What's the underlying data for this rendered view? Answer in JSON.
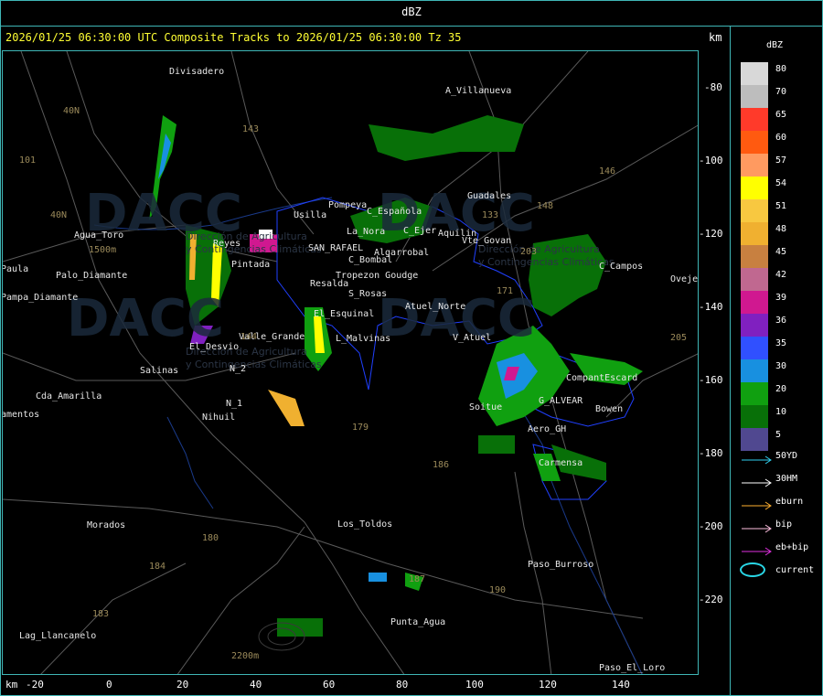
{
  "window": {
    "title": "dBZ"
  },
  "header": {
    "text": "2026/01/25 06:30:00 UTC Composite Tracks to 2026/01/25 06:30:00 Tz 35",
    "km": "km"
  },
  "axes": {
    "x_ticks": [
      "-20",
      "0",
      "20",
      "40",
      "60",
      "80",
      "100",
      "120",
      "140"
    ],
    "y_ticks": [
      "-80",
      "-100",
      "-120",
      "-140",
      "-160",
      "-180",
      "-200",
      "-220"
    ],
    "x_unit": "km"
  },
  "places": [
    "Divisadero",
    "A_Villanueva",
    "Guadales",
    "Usilla",
    "Pompeya",
    "C_Española",
    "La_Nora",
    "C_Ejer",
    "Aquilin",
    "Vte_Govan",
    "Algarrobal",
    "C_Bombal",
    "SAN_RAFAEL",
    "Tropezon Goudge",
    "Resalda",
    "S_Rosas",
    "Atuel_Norte",
    "C_Campos",
    "Oveje",
    "Agua_Toro",
    "Pampa_Diamante",
    "Palo_Diamante",
    "Paula",
    "Pintada",
    "Reyes",
    "El_Desvio",
    "Valle_Grande",
    "El_Esquinal",
    "L_Malvinas",
    "V_Atuel",
    "Salinas",
    "Cda_Amarilla",
    "amentos",
    "N_2",
    "N_1",
    "Nihuil",
    "Soitue",
    "G_ALVEAR",
    "CompantEscard",
    "Bowen",
    "Aero_GH",
    "Carmensa",
    "Morados",
    "Los_Toldos",
    "Paso_Burroso",
    "Lag_Llancanelo",
    "Punta_Agua",
    "Paso_El_Loro",
    "1500m",
    "2200m",
    "40N",
    "101",
    "143",
    "146",
    "133",
    "148",
    "203",
    "171",
    "144",
    "179",
    "186",
    "180",
    "184",
    "183",
    "190",
    "205",
    "187",
    "40N"
  ],
  "watermarks": [
    "DACC",
    "DACC",
    "DACC",
    "DACC"
  ],
  "watermark_sub": [
    "Dirección de Agricultura",
    "y Contingencias Climáticas"
  ],
  "legend": {
    "title": "dBZ",
    "levels": [
      {
        "label": "80",
        "color": "#d8d8d8"
      },
      {
        "label": "70",
        "color": "#bdbdbd"
      },
      {
        "label": "65",
        "color": "#ff3a2a"
      },
      {
        "label": "60",
        "color": "#ff5a10"
      },
      {
        "label": "57",
        "color": "#ff9a60"
      },
      {
        "label": "54",
        "color": "#ffff00"
      },
      {
        "label": "51",
        "color": "#f8c840"
      },
      {
        "label": "48",
        "color": "#f0b030"
      },
      {
        "label": "45",
        "color": "#c88040"
      },
      {
        "label": "42",
        "color": "#c06890"
      },
      {
        "label": "39",
        "color": "#d01890"
      },
      {
        "label": "36",
        "color": "#8020c0"
      },
      {
        "label": "35",
        "color": "#3050ff"
      },
      {
        "label": "30",
        "color": "#1890e0"
      },
      {
        "label": "20",
        "color": "#10a010"
      },
      {
        "label": "10",
        "color": "#087008"
      },
      {
        "label": "5",
        "color": "#504890"
      }
    ],
    "tracks": [
      {
        "label": "50YD",
        "color": "#30d0f0"
      },
      {
        "label": "30HM",
        "color": "#ffffff"
      },
      {
        "label": "eburn",
        "color": "#ffb030"
      },
      {
        "label": "bip",
        "color": "#ffc0e0"
      },
      {
        "label": "eb+bip",
        "color": "#e030e0"
      }
    ],
    "current_label": "current"
  }
}
